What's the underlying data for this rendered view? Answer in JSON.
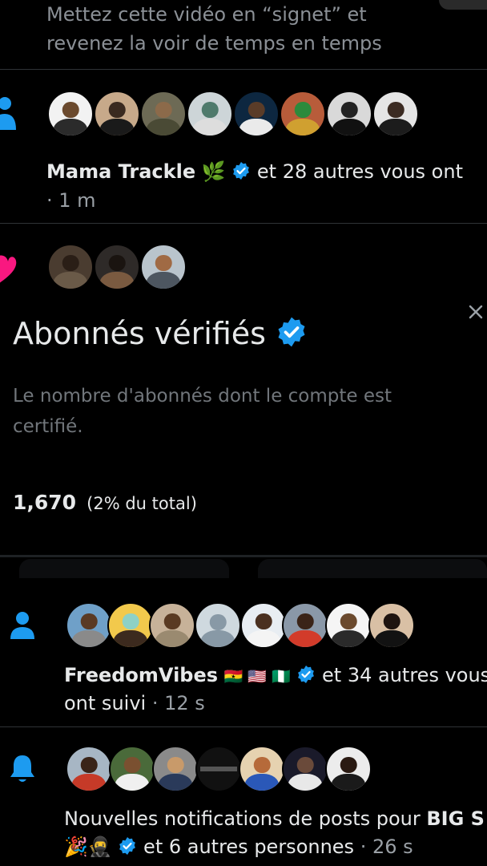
{
  "top_text": {
    "line1": "Mettez cette vidéo en “signet” et",
    "line2": "revenez la voir de temps en temps"
  },
  "notif1": {
    "name": "Mama Trackle",
    "rest": "et 28 autres vous ont",
    "time": "· 1 m",
    "icon": "person-icon"
  },
  "notif2": {
    "icon": "heart-icon"
  },
  "popup": {
    "title": "Abonnés vérifiés",
    "description_line1": "Le nombre d'abonnés dont le compte est",
    "description_line2": "certifié.",
    "count": "1,670",
    "percent": "(2% du total)",
    "close_icon": "close-icon"
  },
  "notif3": {
    "name": "FreedomVibes",
    "flags": "🇬🇭 🇺🇸 🇳🇬",
    "rest": "et 34 autres vous",
    "line2": "ont suivi",
    "time": "· 12 s",
    "icon": "person-icon"
  },
  "notif4": {
    "text": "Nouvelles notifications de posts pour",
    "bold_name": "BIG S",
    "emoji": "🎉🥷",
    "rest": "et 6 autres personnes",
    "time": "· 26 s",
    "icon": "bell-icon"
  },
  "colors": {
    "accent": "#1d9bf0",
    "heart": "#f91880",
    "background": "#000000",
    "muted": "#71767b"
  }
}
